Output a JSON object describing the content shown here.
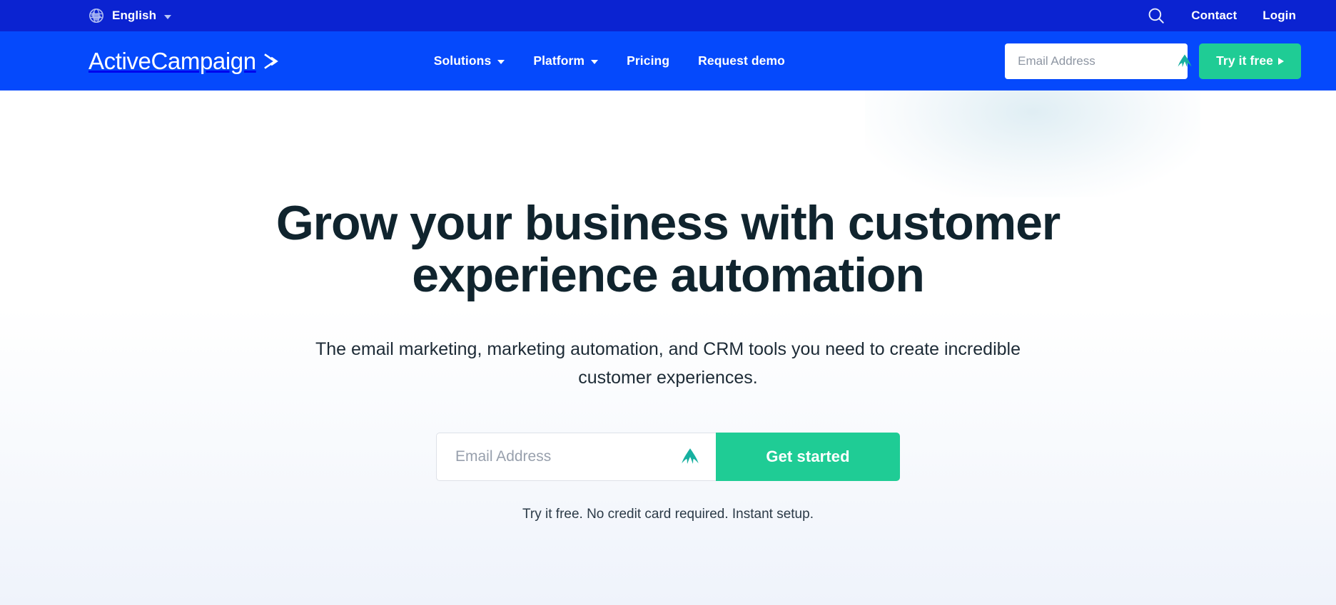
{
  "topbar": {
    "globe_icon": "globe-icon",
    "language": "English",
    "caret_icon": "chevron-down-icon",
    "search_icon": "search-icon",
    "links": [
      {
        "label": "Contact"
      },
      {
        "label": "Login"
      }
    ]
  },
  "navbar": {
    "logo_text": "ActiveCampaign",
    "logo_mark_icon": "chevron-right-logo-icon",
    "nav_items": [
      {
        "label": "Solutions",
        "has_caret": true
      },
      {
        "label": "Platform",
        "has_caret": true
      },
      {
        "label": "Pricing",
        "has_caret": false
      },
      {
        "label": "Request demo",
        "has_caret": false
      }
    ],
    "email": {
      "value": "",
      "placeholder": "Email Address",
      "autofill_icon": "nordpass-mountain-icon"
    },
    "cta": {
      "label": "Try it free",
      "arrow_icon": "triangle-right-icon",
      "color": "#1fcc95"
    }
  },
  "hero": {
    "title": "Grow your business with customer experience automation",
    "subtitle": "The email marketing, marketing automation, and CRM tools you need to create incredible customer experiences.",
    "email": {
      "value": "",
      "placeholder": "Email Address",
      "autofill_icon": "nordpass-mountain-icon"
    },
    "cta": {
      "label": "Get started",
      "color": "#1fcc95"
    },
    "note": "Try it free. No credit card required. Instant setup."
  },
  "colors": {
    "topbar_blue": "#0b23d1",
    "navbar_blue": "#0549fc",
    "accent_teal": "#1fcc95",
    "headline_navy": "#10242e",
    "hero_bg_bottom": "#eff3fb"
  }
}
